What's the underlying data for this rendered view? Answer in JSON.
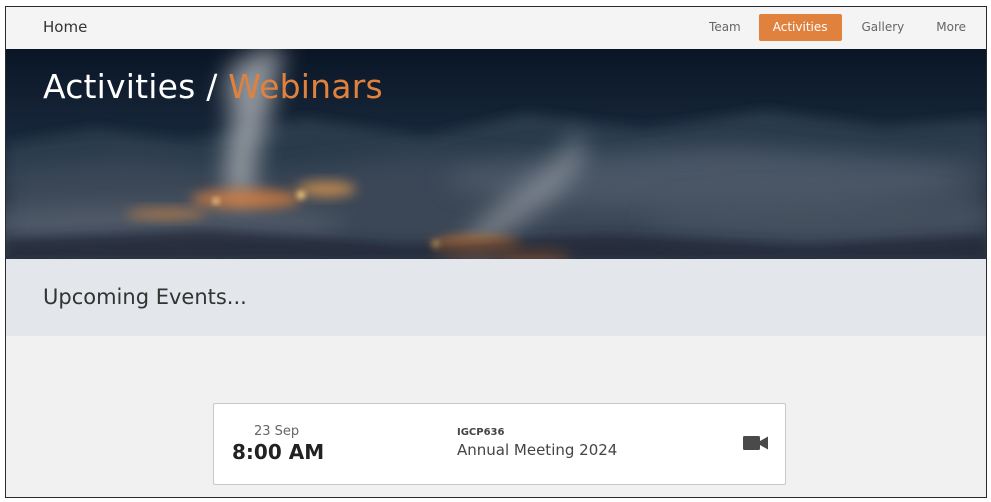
{
  "nav": {
    "brand": "Home",
    "links": [
      {
        "label": "Team",
        "active": false
      },
      {
        "label": "Activities",
        "active": true
      },
      {
        "label": "Gallery",
        "active": false
      },
      {
        "label": "More",
        "active": false
      }
    ]
  },
  "hero": {
    "title_prefix": "Activities / ",
    "title_accent": "Webinars"
  },
  "upcoming": {
    "heading": "Upcoming Events..."
  },
  "event": {
    "date": "23 Sep",
    "time": "8:00 AM",
    "code": "IGCP636",
    "name": "Annual Meeting 2024",
    "icon": "video-camera-icon"
  },
  "colors": {
    "accent": "#e0823e",
    "nav_bg": "#f4f4f4",
    "band_bg": "#e3e6ea",
    "page_bg": "#f1f1f1"
  }
}
